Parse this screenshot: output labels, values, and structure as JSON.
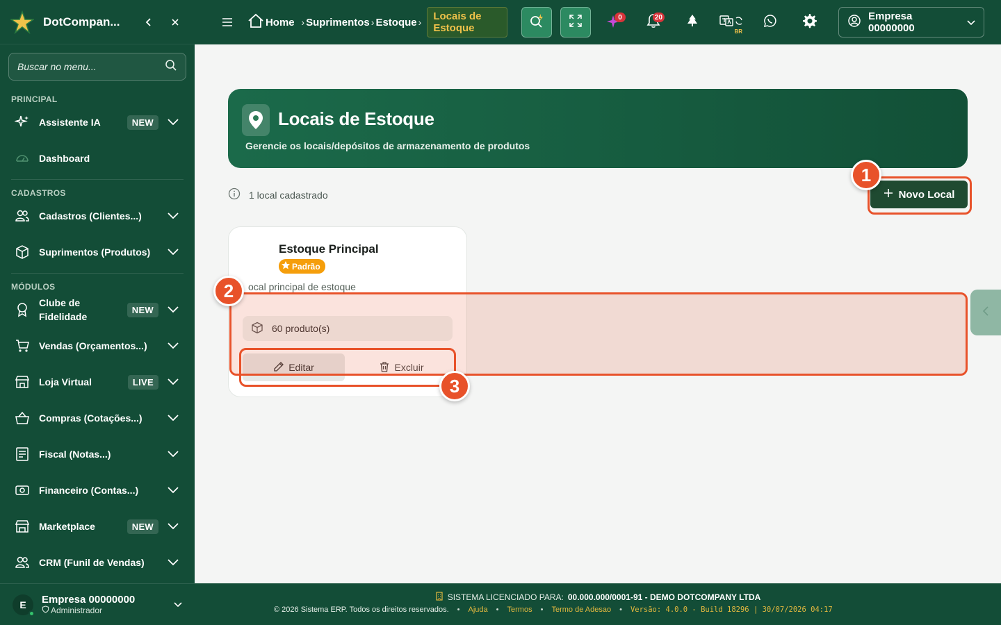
{
  "sidebar": {
    "brand": "DotCompan...",
    "search_placeholder": "Buscar no menu...",
    "sections": {
      "principal": "PRINCIPAL",
      "cadastros": "CADASTROS",
      "modulos": "MÓDULOS"
    },
    "items": [
      {
        "label": "Assistente IA",
        "badge": "NEW",
        "icon": "sparkles-icon"
      },
      {
        "label": "Dashboard",
        "icon": "gauge-icon"
      },
      {
        "label": "Cadastros (Clientes...)",
        "icon": "users-icon"
      },
      {
        "label": "Suprimentos (Produtos)",
        "icon": "box-icon"
      },
      {
        "label": "Clube de Fidelidade",
        "badge": "NEW",
        "icon": "award-icon"
      },
      {
        "label": "Vendas (Orçamentos...)",
        "icon": "cart-icon"
      },
      {
        "label": "Loja Virtual",
        "badge": "LIVE",
        "icon": "store-icon"
      },
      {
        "label": "Compras (Cotações...)",
        "icon": "basket-icon"
      },
      {
        "label": "Fiscal (Notas...)",
        "icon": "receipt-icon"
      },
      {
        "label": "Financeiro (Contas...)",
        "icon": "money-icon"
      },
      {
        "label": "Marketplace",
        "badge": "NEW",
        "icon": "shop-icon"
      },
      {
        "label": "CRM (Funil de Vendas)",
        "icon": "users-icon"
      }
    ],
    "user": {
      "initial": "E",
      "name": "Empresa 00000000",
      "role": "Administrador"
    }
  },
  "topbar": {
    "breadcrumbs": [
      "Home",
      "Suprimentos",
      "Estoque"
    ],
    "current": "Locais de Estoque",
    "ai_count": "0",
    "notif_count": "20",
    "region": "BR",
    "company": "Empresa 00000000"
  },
  "page": {
    "title": "Locais de Estoque",
    "subtitle": "Gerencie os locais/depósitos de armazenamento de produtos",
    "count_text": "1 local cadastrado",
    "new_button": "Novo Local",
    "card": {
      "title": "Estoque Principal",
      "badge": "Padrão",
      "description": "ocal principal de estoque",
      "stat": "60 produto(s)",
      "edit_label": "Editar",
      "delete_label": "Excluir"
    },
    "markers": [
      "1",
      "2",
      "3"
    ]
  },
  "footer": {
    "license_key": "SISTEMA LICENCIADO PARA:",
    "license_value": "00.000.000/0001-91 - DEMO DOTCOMPANY LTDA",
    "copyright": "© 2026 Sistema ERP. Todos os direitos reservados.",
    "links": [
      "Ajuda",
      "Termos",
      "Termo de Adesao"
    ],
    "version": "Versão: 4.0.0 - Build 18296 | 30/07/2026 04:17"
  },
  "colors": {
    "primary": "#134d37",
    "accent_gold": "#f0c24a",
    "highlight": "#e8522a",
    "badge_orange": "#f59e0b"
  }
}
